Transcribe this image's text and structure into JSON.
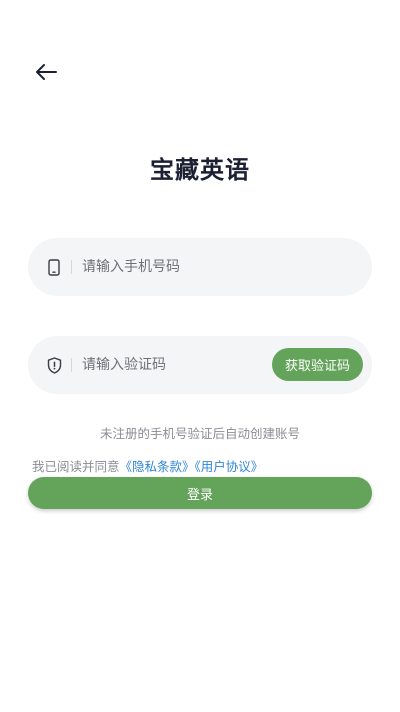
{
  "header": {
    "back_icon": "arrow-left-icon"
  },
  "app": {
    "title": "宝藏英语"
  },
  "phone_field": {
    "icon": "phone-icon",
    "value": "",
    "placeholder": "请输入手机号码"
  },
  "code_field": {
    "icon": "shield-icon",
    "value": "",
    "placeholder": "请输入验证码",
    "get_code_label": "获取验证码"
  },
  "hint": {
    "text": "未注册的手机号验证后自动创建账号"
  },
  "agreement": {
    "prefix": "我已阅读并同意",
    "privacy_link": "《隐私条款》",
    "user_link": "《用户协议》"
  },
  "login": {
    "label": "登录"
  },
  "colors": {
    "accent": "#64a35a",
    "link": "#2f86d6",
    "title": "#1c2033",
    "field_bg": "#f4f5f7"
  }
}
